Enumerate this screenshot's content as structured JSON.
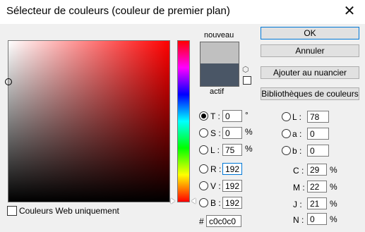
{
  "window": {
    "title": "Sélecteur de couleurs (couleur de premier plan)",
    "close_glyph": "✕"
  },
  "preview": {
    "new_label": "nouveau",
    "current_label": "actif",
    "new_color": "#c0c0c0",
    "current_color": "#4a5666"
  },
  "icons": {
    "cube": "⬡"
  },
  "buttons": {
    "ok": "OK",
    "cancel": "Annuler",
    "add_swatch": "Ajouter au nuancier",
    "libraries": "Bibliothèques de couleurs"
  },
  "hsb": {
    "h": {
      "label": "T :",
      "value": "0",
      "unit": "°"
    },
    "s": {
      "label": "S :",
      "value": "0",
      "unit": "%"
    },
    "b": {
      "label": "L :",
      "value": "75",
      "unit": "%"
    }
  },
  "rgb": {
    "r": {
      "label": "R :",
      "value": "192"
    },
    "g": {
      "label": "V :",
      "value": "192"
    },
    "b": {
      "label": "B :",
      "value": "192"
    }
  },
  "lab": {
    "l": {
      "label": "L :",
      "value": "78"
    },
    "a": {
      "label": "a :",
      "value": "0"
    },
    "b": {
      "label": "b :",
      "value": "0"
    }
  },
  "cmyk": {
    "c": {
      "label": "C :",
      "value": "29",
      "unit": "%"
    },
    "m": {
      "label": "M :",
      "value": "22",
      "unit": "%"
    },
    "y": {
      "label": "J :",
      "value": "21",
      "unit": "%"
    },
    "k": {
      "label": "N :",
      "value": "0",
      "unit": "%"
    }
  },
  "hex": {
    "label": "#",
    "value": "c0c0c0"
  },
  "web_only": {
    "label": "Couleurs Web uniquement",
    "checked": false
  }
}
